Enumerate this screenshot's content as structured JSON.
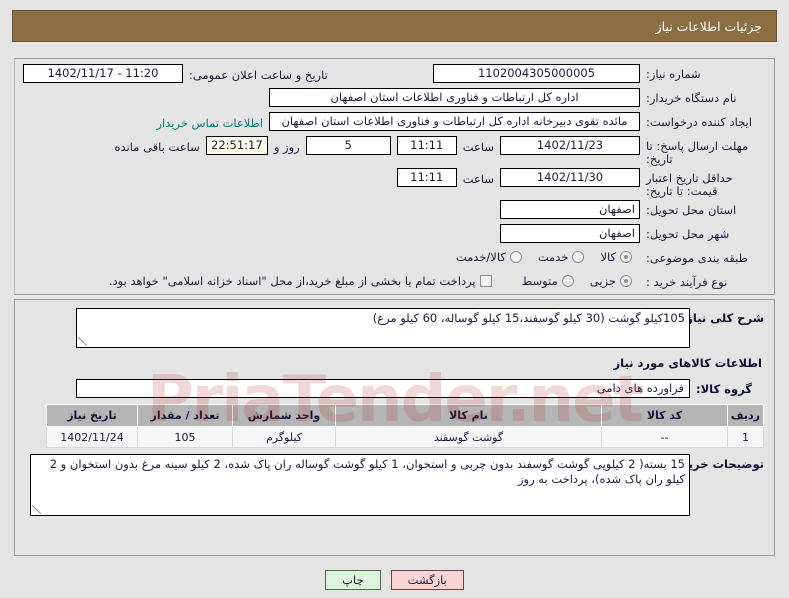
{
  "header": {
    "title": "جزئیات اطلاعات نیاز"
  },
  "form": {
    "need_number": {
      "label": "شماره نیاز:",
      "value": "1102004305000005"
    },
    "public_announce": {
      "label": "تاریخ و ساعت اعلان عمومی:",
      "value": "11:20 - 1402/11/17"
    },
    "buyer_org": {
      "label": "نام دستگاه خریدار:",
      "value": "اداره کل ارتباطات و فناوری اطلاعات استان اصفهان"
    },
    "requester": {
      "label": "ایجاد کننده درخواست:",
      "value": "مائده تقوی دبیرخانه اداره کل ارتباطات و فناوری اطلاعات استان اصفهان",
      "contact_link": "اطلاعات تماس خریدار"
    },
    "response_deadline": {
      "label": "مهلت ارسال پاسخ: تا تاریخ:",
      "date": "1402/11/23",
      "time_label": "ساعت",
      "time": "11:11",
      "days": "5",
      "days_label": "روز و",
      "countdown": "22:51:17",
      "countdown_label": "ساعت باقی مانده"
    },
    "price_validity": {
      "label": "حداقل تاریخ اعتبار قیمت: تا تاریخ:",
      "date": "1402/11/30",
      "time_label": "ساعت",
      "time": "11:11"
    },
    "delivery_province": {
      "label": "استان محل تحویل:",
      "value": "اصفهان"
    },
    "delivery_city": {
      "label": "شهر محل تحویل:",
      "value": "اصفهان"
    },
    "subject_category": {
      "label": "طبقه بندی موضوعی:",
      "options": [
        {
          "text": "کالا",
          "selected": true
        },
        {
          "text": "خدمت",
          "selected": false
        },
        {
          "text": "کالا/خدمت",
          "selected": false
        }
      ]
    },
    "purchase_process": {
      "label": "نوع فرآیند خرید :",
      "options": [
        {
          "text": "جزیی",
          "selected": true
        },
        {
          "text": "متوسط",
          "selected": false
        }
      ],
      "checkbox_label": "پرداخت تمام یا بخشی از مبلغ خرید،از محل \"اسناد خزانه اسلامی\" خواهد بود.",
      "checkbox_checked": false
    },
    "need_description": {
      "label": "شرح کلی نیاز:",
      "value": "105کیلو گوشت (30 کیلو گوسفند،15 کیلو گوساله، 60 کیلو مرغ)"
    },
    "goods_section_title": "اطلاعات کالاهای مورد نیاز",
    "goods_group": {
      "label": "گروه کالا:",
      "value": "فراورده های دامی"
    },
    "buyer_notes": {
      "label": "توضیحات خریدار:",
      "value": "15 بسته( 2 کیلویی گوشت گوسفند بدون چربی و استخوان، 1 کیلو گوشت گوساله ران پاک شده، 2 کیلو سینه مرغ بدون استخوان و 2 کیلو ران پاک شده)، پرداخت به روز"
    }
  },
  "goods_table": {
    "columns": [
      "ردیف",
      "کد کالا",
      "نام کالا",
      "واحد شمارش",
      "تعداد / مقدار",
      "تاریخ نیاز"
    ],
    "rows": [
      {
        "index": "1",
        "code": "--",
        "name": "گوشت گوسفند",
        "unit": "کیلوگرم",
        "quantity": "105",
        "need_date": "1402/11/24"
      }
    ]
  },
  "footer": {
    "back_button": "بازگشت",
    "print_button": "چاپ"
  },
  "watermark": {
    "text": "PriaTender.net"
  },
  "colors": {
    "header_bar": "#8c6e43",
    "page_bg": "#e4e4e4",
    "link": "#00807a",
    "table_header": "#b5b5b5",
    "back_button": "#fad4d4",
    "print_button": "#ddf3dd",
    "countdown_field": "#fbfbe8"
  }
}
